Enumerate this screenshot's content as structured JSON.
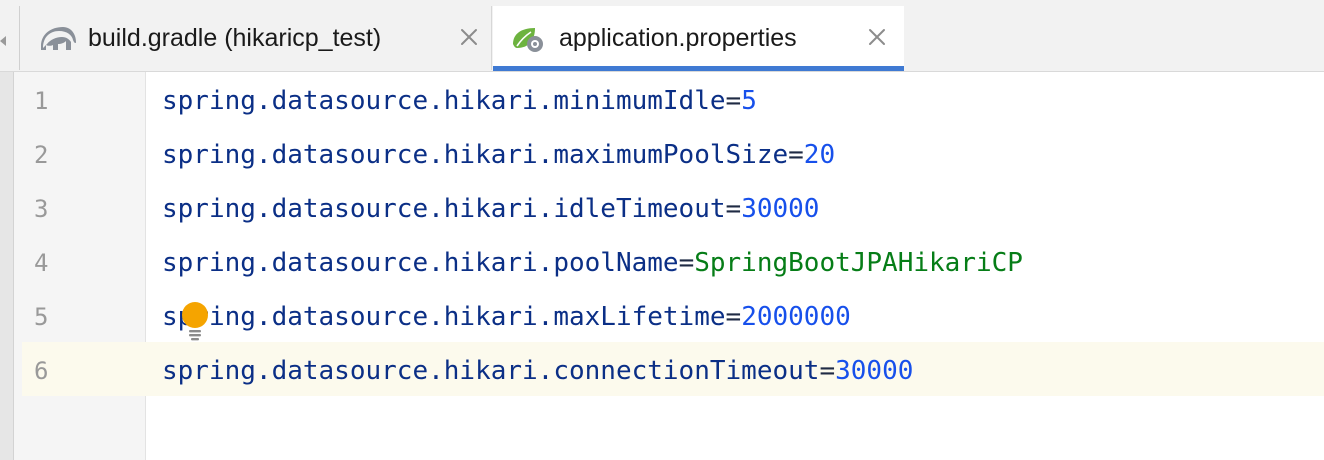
{
  "tabs": [
    {
      "label": "build.gradle (hikaricp_test)",
      "icon": "gradle-elephant-icon",
      "active": false
    },
    {
      "label": "application.properties",
      "icon": "spring-properties-icon",
      "active": true
    }
  ],
  "editor": {
    "current_line": 6,
    "lines": [
      {
        "number": "1",
        "key": "spring.datasource.hikari.minimumIdle",
        "sep": "=",
        "value": "5",
        "value_type": "number"
      },
      {
        "number": "2",
        "key": "spring.datasource.hikari.maximumPoolSize",
        "sep": "=",
        "value": "20",
        "value_type": "number"
      },
      {
        "number": "3",
        "key": "spring.datasource.hikari.idleTimeout",
        "sep": "=",
        "value": "30000",
        "value_type": "number"
      },
      {
        "number": "4",
        "key": "spring.datasource.hikari.poolName",
        "sep": "=",
        "value": "SpringBootJPAHikariCP",
        "value_type": "string"
      },
      {
        "number": "5",
        "key": "spring.datasource.hikari.maxLifetime",
        "sep": "=",
        "value": "2000000",
        "value_type": "number"
      },
      {
        "number": "6",
        "key": "spring.datasource.hikari.connectionTimeout",
        "sep": "=",
        "value": "30000",
        "value_type": "number"
      }
    ]
  },
  "colors": {
    "key": "#0b2f86",
    "number_value": "#1750eb",
    "string_value": "#067d17",
    "active_tab_underline": "#3f7ad3",
    "current_line": "#fcfaed",
    "bulb": "#f5a400"
  }
}
